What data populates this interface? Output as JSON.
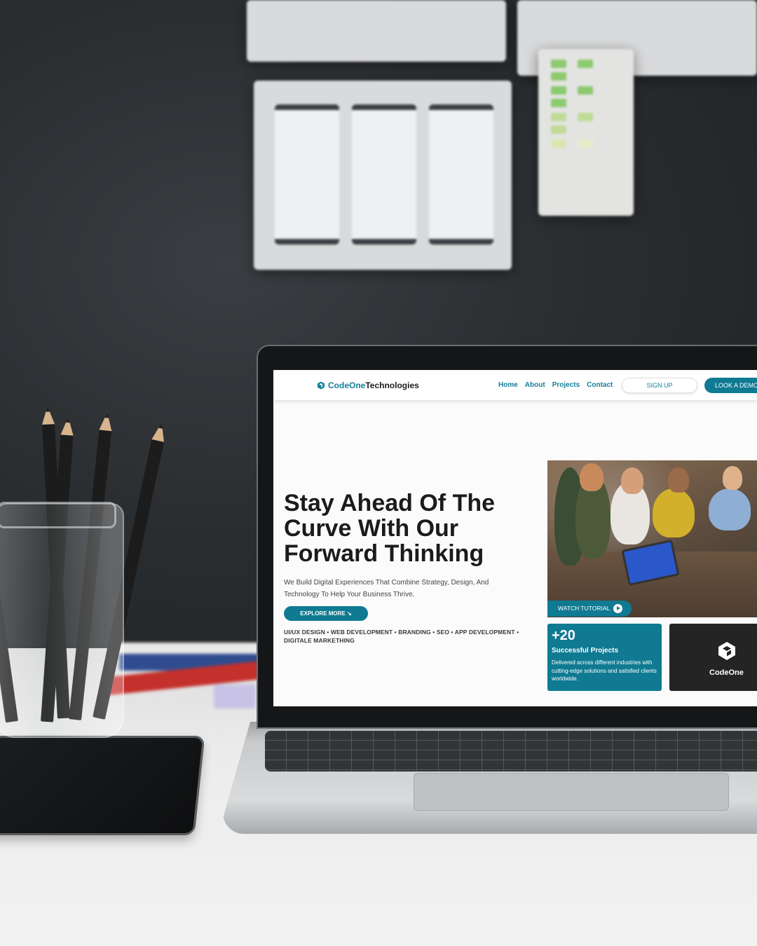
{
  "site": {
    "logo": {
      "prefix": "CodeOne",
      "suffix": "Technologies"
    },
    "nav": [
      {
        "label": "Home"
      },
      {
        "label": "About"
      },
      {
        "label": "Projects"
      },
      {
        "label": "Contact"
      }
    ],
    "signup_label": "SIGN UP",
    "demo_label": "LOOK A DEMO",
    "hero": {
      "title": "Stay Ahead Of The Curve With Our Forward Thinking",
      "subtitle": "We Build Digital Experiences That Combine Strategy, Design, And Technology To Help Your Business Thrive.",
      "cta_label": "EXPLORE MORE ↘",
      "services": "UI/UX DESIGN  •  WEB DEVELOPMENT  •  BRANDING  •  SEO  •  APP DEVELOPMENT  •  DIGITALE MARKETHING"
    },
    "watch_label": "WATCH TUTORIAL",
    "stats": {
      "number": "+20",
      "label": "Successful Projects",
      "description": "Delivered across different industries with cutting-edge solutions and satisfied clients worldwide."
    },
    "brand_card": {
      "name": "CodeOne"
    },
    "icons": [
      "logo-icon",
      "play-icon",
      "cube-logo-icon",
      "arrow-down-right-icon"
    ],
    "colors": {
      "accent": "#0f7a92",
      "text_dark": "#1b1b1b",
      "card_dark": "#242424"
    }
  }
}
